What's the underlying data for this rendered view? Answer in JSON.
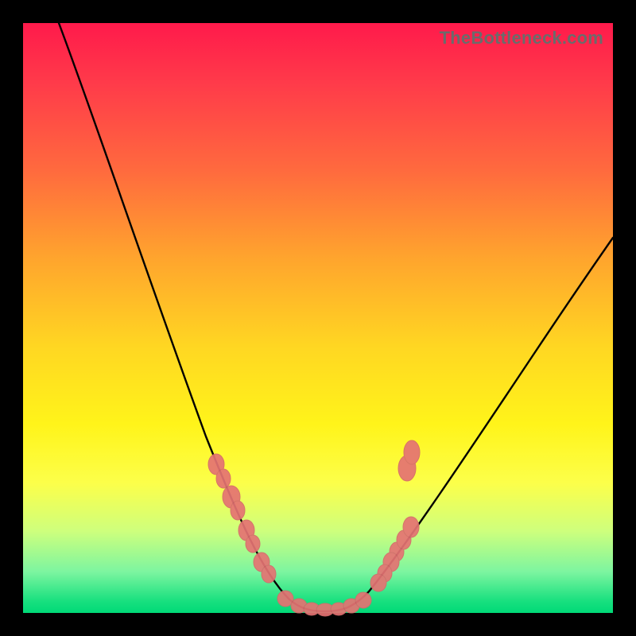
{
  "watermark": "TheBottleneck.com",
  "colors": {
    "frame": "#000000",
    "gradient_top": "#ff1a4b",
    "gradient_bottom": "#00d977",
    "curve": "#000000",
    "markers": "#e57373"
  },
  "chart_data": {
    "type": "line",
    "title": "",
    "xlabel": "",
    "ylabel": "",
    "xlim": [
      0,
      100
    ],
    "ylim": [
      0,
      100
    ],
    "grid": false,
    "legend": false,
    "series": [
      {
        "name": "bottleneck-curve",
        "x": [
          0,
          5,
          10,
          15,
          20,
          25,
          30,
          35,
          38,
          41,
          44,
          46,
          48,
          50,
          52,
          55,
          60,
          65,
          70,
          75,
          80,
          85,
          90,
          95,
          100
        ],
        "y": [
          100,
          89,
          77,
          66,
          55,
          44,
          33,
          22,
          15,
          9,
          4,
          1.5,
          0.5,
          0,
          0.5,
          2,
          7,
          14,
          22,
          30,
          38,
          45,
          52,
          58,
          63
        ]
      }
    ],
    "markers": [
      {
        "name": "left-cluster",
        "x": [
          30,
          31,
          33,
          34,
          36,
          37,
          39,
          40
        ],
        "y": [
          26,
          24,
          20,
          18,
          14,
          12,
          9,
          7
        ]
      },
      {
        "name": "floor-cluster",
        "x": [
          44,
          46,
          48,
          50,
          52,
          54,
          55
        ],
        "y": [
          1.5,
          0.6,
          0.3,
          0.2,
          0.3,
          0.8,
          1.4
        ]
      },
      {
        "name": "right-cluster",
        "x": [
          57,
          58,
          60,
          61,
          63,
          64
        ],
        "y": [
          22,
          20,
          16,
          14,
          11,
          9
        ]
      }
    ],
    "note": "Axis values are relative percentages (0-100) estimated from the unlabeled gradient plot. y=0 is the green floor (no bottleneck), y=100 is the red top (severe bottleneck). The curve dips to ~0 near x≈50 and rises steeply to the left (toward 100) and moderately to the right (toward ~63)."
  }
}
